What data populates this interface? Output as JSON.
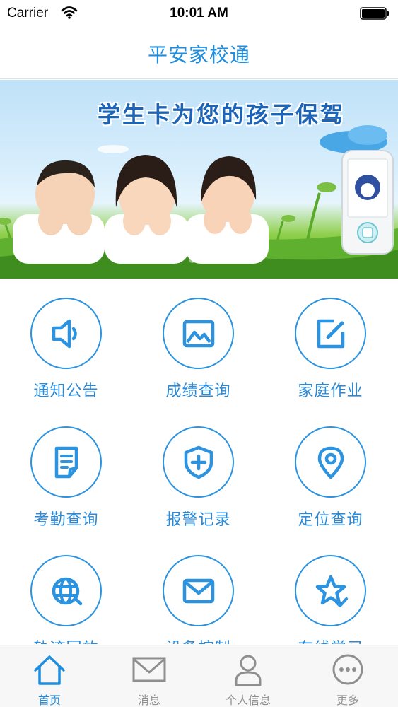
{
  "status_bar": {
    "carrier": "Carrier",
    "time": "10:01 AM"
  },
  "nav": {
    "title": "平安家校通"
  },
  "banner": {
    "slogan": "学生卡为您的孩子保驾",
    "slide_count": 4,
    "active_slide": 1
  },
  "grid": {
    "items": [
      {
        "label": "通知公告",
        "icon": "speaker-icon"
      },
      {
        "label": "成绩查询",
        "icon": "image-icon"
      },
      {
        "label": "家庭作业",
        "icon": "edit-icon"
      },
      {
        "label": "考勤查询",
        "icon": "document-icon"
      },
      {
        "label": "报警记录",
        "icon": "shield-plus-icon"
      },
      {
        "label": "定位查询",
        "icon": "location-pin-icon"
      },
      {
        "label": "轨迹回放",
        "icon": "globe-icon"
      },
      {
        "label": "设备控制",
        "icon": "mail-icon"
      },
      {
        "label": "在线学习",
        "icon": "star-check-icon"
      }
    ]
  },
  "tabs": [
    {
      "label": "首页",
      "icon": "home-icon",
      "active": true
    },
    {
      "label": "消息",
      "icon": "envelope-icon",
      "active": false
    },
    {
      "label": "个人信息",
      "icon": "person-icon",
      "active": false
    },
    {
      "label": "更多",
      "icon": "more-icon",
      "active": false
    }
  ],
  "colors": {
    "accent": "#1f8ee0",
    "icon_stroke": "#2b93e0",
    "tab_inactive": "#8f8f8f"
  }
}
